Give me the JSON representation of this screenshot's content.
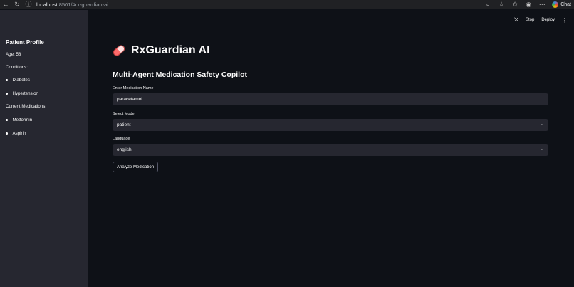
{
  "browser": {
    "url_host": "localhost",
    "url_rest": ":8501/#rx-guardian-ai",
    "chat_label": "Chat"
  },
  "sidebar": {
    "title": "Patient Profile",
    "age": "Age: 58",
    "conditions_label": "Conditions:",
    "conditions": [
      "Diabetes",
      "Hypertension"
    ],
    "medications_label": "Current Medications:",
    "medications": [
      "Metformin",
      "Aspirin"
    ]
  },
  "toolbar": {
    "stop_label": "Stop",
    "deploy_label": "Deploy"
  },
  "main": {
    "title": "RxGuardian AI",
    "subtitle": "Multi-Agent Medication Safety Copilot",
    "medication_label": "Enter Medication Name",
    "medication_value": "paracetamol",
    "mode_label": "Select Mode",
    "mode_value": "patient",
    "language_label": "Language",
    "language_value": "english",
    "analyze_label": "Analyze Medication"
  },
  "colors": {
    "background": "#0e1117",
    "sidebar": "#262730",
    "input_bg": "#262730",
    "text": "#fafafa"
  },
  "icons": [
    "back-icon",
    "reload-icon",
    "info-icon",
    "zoom-icon",
    "star-icon",
    "favorites-icon",
    "extension-icon",
    "more-icon",
    "pill-icon",
    "stop-icon",
    "kebab-icon",
    "chevron-down-icon"
  ]
}
